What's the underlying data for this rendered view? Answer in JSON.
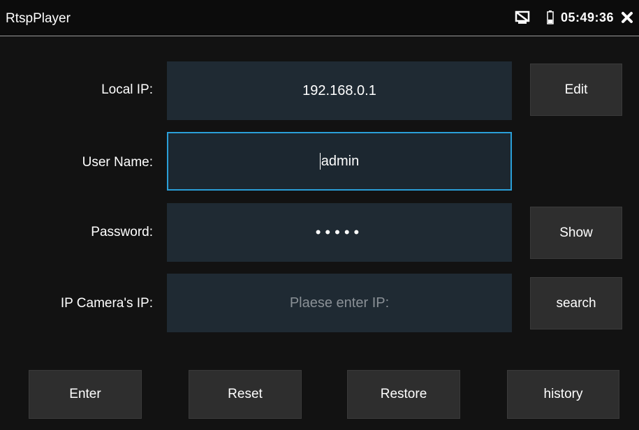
{
  "app": {
    "title": "RtspPlayer"
  },
  "status_bar": {
    "time": "05:49:36",
    "icons": [
      "screen-off-icon",
      "battery-icon",
      "close-icon"
    ]
  },
  "form": {
    "local_ip": {
      "label": "Local IP:",
      "value": "192.168.0.1",
      "button": "Edit"
    },
    "user_name": {
      "label": "User Name:",
      "value": "admin"
    },
    "password": {
      "label": "Password:",
      "value": "•••••",
      "button": "Show"
    },
    "camera_ip": {
      "label": "IP Camera's IP:",
      "placeholder": "Plaese enter IP:",
      "button": "search"
    }
  },
  "actions": {
    "enter": "Enter",
    "reset": "Reset",
    "restore": "Restore",
    "history": "history"
  },
  "colors": {
    "focus_border": "#2a9fd8",
    "field_bg": "#1f2a33",
    "button_bg": "#2e2e2e"
  }
}
